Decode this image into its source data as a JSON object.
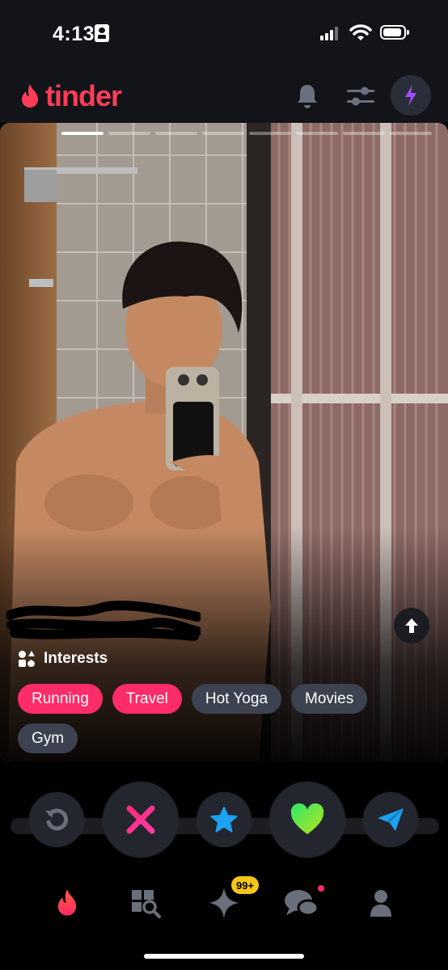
{
  "status_bar": {
    "time": "4:13"
  },
  "app": {
    "name": "tinder",
    "brand_color": "#fd3d57"
  },
  "header": {
    "icons": [
      "bell-icon",
      "sliders-icon",
      "lightning-icon"
    ],
    "boost_color": "#a24bff"
  },
  "card": {
    "photo_count": 8,
    "active_photo": 1,
    "interests_label": "Interests",
    "interests": [
      {
        "label": "Running",
        "shared": true
      },
      {
        "label": "Travel",
        "shared": true
      },
      {
        "label": "Hot Yoga",
        "shared": false
      },
      {
        "label": "Movies",
        "shared": false
      },
      {
        "label": "Gym",
        "shared": false
      }
    ]
  },
  "actions": [
    "rewind-icon",
    "nope-icon",
    "super-like-icon",
    "like-icon",
    "boost-send-icon"
  ],
  "tabs": [
    "flame-icon",
    "explore-icon",
    "sparkle-icon",
    "chat-icon",
    "profile-icon"
  ],
  "tab_badge": "99+"
}
